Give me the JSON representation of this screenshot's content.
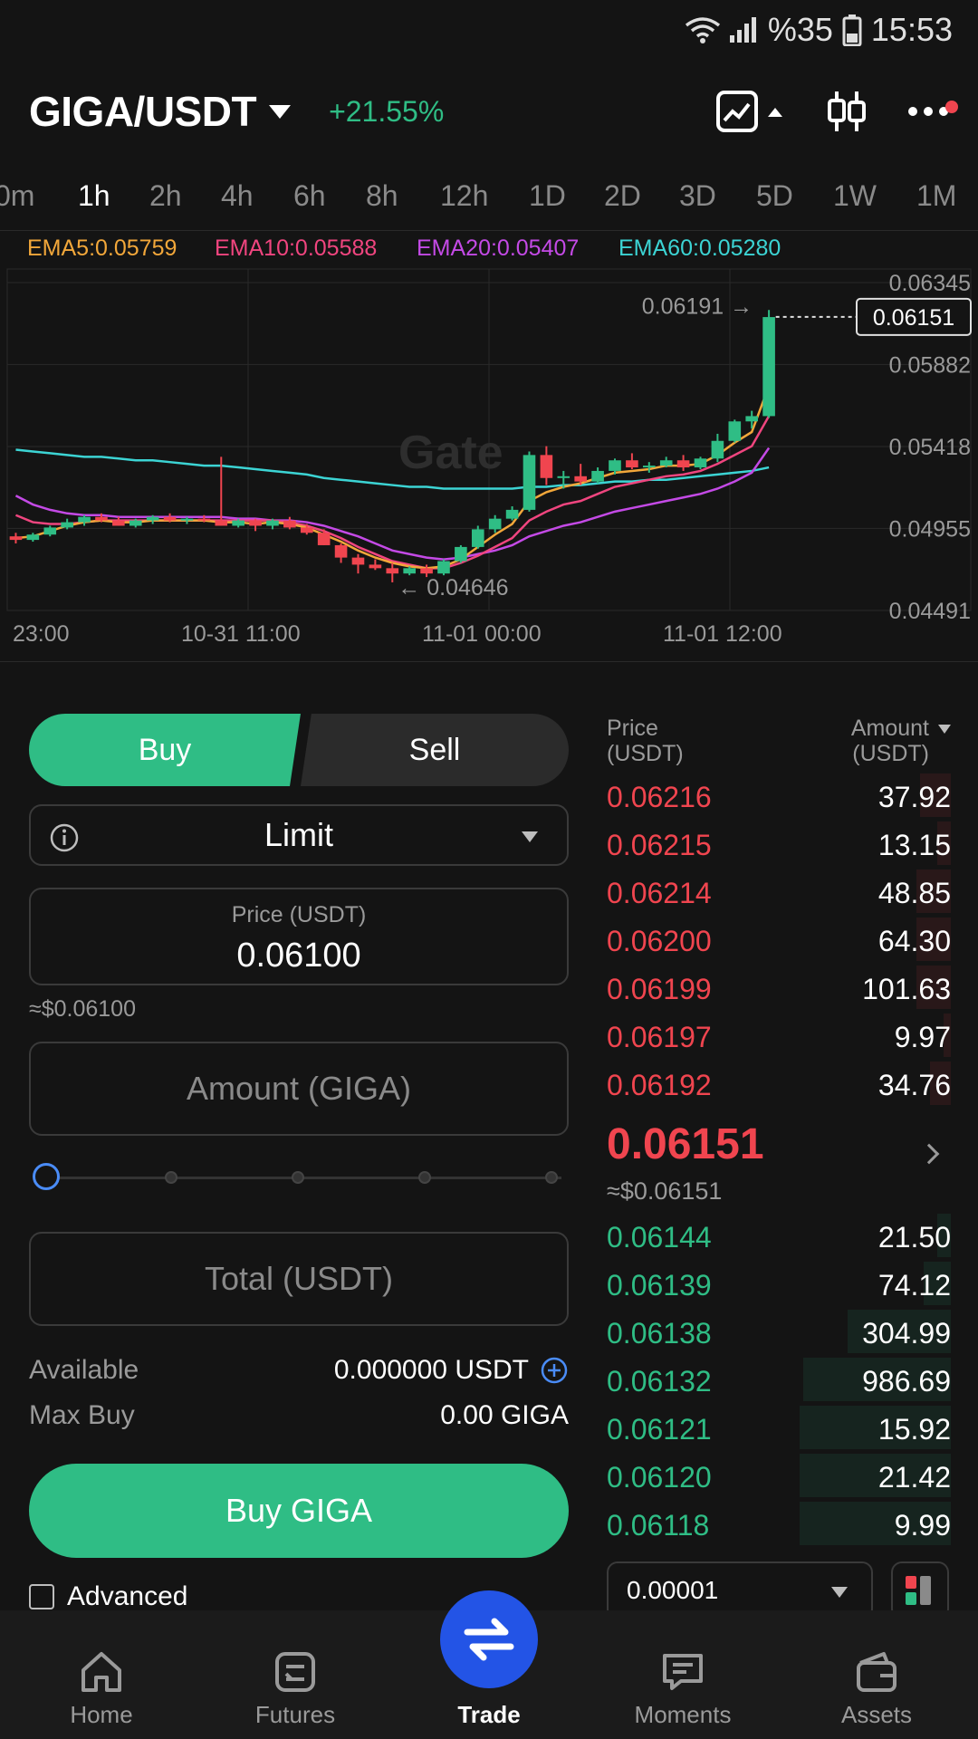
{
  "status_bar": {
    "battery": "%35",
    "time": "15:53"
  },
  "header": {
    "pair": "GIGA/USDT",
    "change": "+21.55%",
    "icons": [
      "chart-type-icon",
      "candlestick-icon",
      "more-icon"
    ]
  },
  "timeframes": [
    "0m",
    "1h",
    "2h",
    "4h",
    "6h",
    "8h",
    "12h",
    "1D",
    "2D",
    "3D",
    "5D",
    "1W",
    "1M"
  ],
  "active_timeframe": "1h",
  "ema": {
    "ema5": "EMA5:0.05759",
    "ema10": "EMA10:0.05588",
    "ema20": "EMA20:0.05407",
    "ema60": "EMA60:0.05280",
    "colors": {
      "ema5": "#f2a73a",
      "ema10": "#f0457f",
      "ema20": "#c44ae6",
      "ema60": "#3cd4d4"
    }
  },
  "chart_data": {
    "type": "candlestick",
    "y_ticks": [
      "0.06345",
      "0.05882",
      "0.05418",
      "0.04955",
      "0.04491"
    ],
    "ylim": [
      0.04491,
      0.06345
    ],
    "x_ticks": [
      "23:00",
      "10-31 11:00",
      "11-01 00:00",
      "11-01 12:00"
    ],
    "high_label": "0.06191",
    "low_label": "0.04646",
    "current_price_tag": "0.06151",
    "watermark": "Gate",
    "candles": [
      {
        "o": 0.0491,
        "h": 0.0493,
        "l": 0.0487,
        "c": 0.0489
      },
      {
        "o": 0.0489,
        "h": 0.0493,
        "l": 0.0488,
        "c": 0.0492
      },
      {
        "o": 0.0492,
        "h": 0.0497,
        "l": 0.0491,
        "c": 0.0496
      },
      {
        "o": 0.0496,
        "h": 0.0501,
        "l": 0.0495,
        "c": 0.0499
      },
      {
        "o": 0.0499,
        "h": 0.0503,
        "l": 0.0497,
        "c": 0.0502
      },
      {
        "o": 0.0502,
        "h": 0.0504,
        "l": 0.0499,
        "c": 0.05
      },
      {
        "o": 0.05,
        "h": 0.0502,
        "l": 0.0497,
        "c": 0.0497
      },
      {
        "o": 0.0497,
        "h": 0.0501,
        "l": 0.0496,
        "c": 0.05
      },
      {
        "o": 0.05,
        "h": 0.0503,
        "l": 0.0498,
        "c": 0.0502
      },
      {
        "o": 0.0502,
        "h": 0.0504,
        "l": 0.0499,
        "c": 0.05
      },
      {
        "o": 0.05,
        "h": 0.0502,
        "l": 0.0498,
        "c": 0.0501
      },
      {
        "o": 0.0501,
        "h": 0.0503,
        "l": 0.0499,
        "c": 0.05
      },
      {
        "o": 0.05,
        "h": 0.0536,
        "l": 0.0497,
        "c": 0.0497
      },
      {
        "o": 0.0497,
        "h": 0.0501,
        "l": 0.0496,
        "c": 0.05
      },
      {
        "o": 0.05,
        "h": 0.0501,
        "l": 0.0494,
        "c": 0.0497
      },
      {
        "o": 0.0497,
        "h": 0.0501,
        "l": 0.0495,
        "c": 0.05
      },
      {
        "o": 0.05,
        "h": 0.0502,
        "l": 0.0495,
        "c": 0.0496
      },
      {
        "o": 0.0496,
        "h": 0.0498,
        "l": 0.0492,
        "c": 0.0493
      },
      {
        "o": 0.0493,
        "h": 0.0495,
        "l": 0.0486,
        "c": 0.0486
      },
      {
        "o": 0.0486,
        "h": 0.0487,
        "l": 0.0476,
        "c": 0.0479
      },
      {
        "o": 0.0479,
        "h": 0.0481,
        "l": 0.047,
        "c": 0.0475
      },
      {
        "o": 0.0475,
        "h": 0.0478,
        "l": 0.0472,
        "c": 0.0473
      },
      {
        "o": 0.0473,
        "h": 0.0476,
        "l": 0.0465,
        "c": 0.047
      },
      {
        "o": 0.047,
        "h": 0.0474,
        "l": 0.0469,
        "c": 0.0473
      },
      {
        "o": 0.0473,
        "h": 0.0475,
        "l": 0.0468,
        "c": 0.047
      },
      {
        "o": 0.047,
        "h": 0.0478,
        "l": 0.0469,
        "c": 0.0477
      },
      {
        "o": 0.0477,
        "h": 0.0486,
        "l": 0.0476,
        "c": 0.0485
      },
      {
        "o": 0.0485,
        "h": 0.0497,
        "l": 0.0484,
        "c": 0.0495
      },
      {
        "o": 0.0495,
        "h": 0.0503,
        "l": 0.0493,
        "c": 0.0501
      },
      {
        "o": 0.0501,
        "h": 0.0508,
        "l": 0.05,
        "c": 0.0506
      },
      {
        "o": 0.0506,
        "h": 0.0539,
        "l": 0.0505,
        "c": 0.0537
      },
      {
        "o": 0.0537,
        "h": 0.0542,
        "l": 0.052,
        "c": 0.0524
      },
      {
        "o": 0.0524,
        "h": 0.0528,
        "l": 0.0518,
        "c": 0.0525
      },
      {
        "o": 0.0525,
        "h": 0.0532,
        "l": 0.052,
        "c": 0.0522
      },
      {
        "o": 0.0522,
        "h": 0.053,
        "l": 0.0521,
        "c": 0.0528
      },
      {
        "o": 0.0528,
        "h": 0.0535,
        "l": 0.0526,
        "c": 0.0534
      },
      {
        "o": 0.0534,
        "h": 0.0538,
        "l": 0.0529,
        "c": 0.053
      },
      {
        "o": 0.053,
        "h": 0.0533,
        "l": 0.0527,
        "c": 0.0531
      },
      {
        "o": 0.0531,
        "h": 0.0536,
        "l": 0.053,
        "c": 0.0534
      },
      {
        "o": 0.0534,
        "h": 0.0537,
        "l": 0.0528,
        "c": 0.053
      },
      {
        "o": 0.053,
        "h": 0.0536,
        "l": 0.0529,
        "c": 0.0535
      },
      {
        "o": 0.0535,
        "h": 0.0549,
        "l": 0.0533,
        "c": 0.0545
      },
      {
        "o": 0.0545,
        "h": 0.0557,
        "l": 0.0544,
        "c": 0.0556
      },
      {
        "o": 0.0556,
        "h": 0.0562,
        "l": 0.0552,
        "c": 0.0559
      },
      {
        "o": 0.0559,
        "h": 0.0619,
        "l": 0.0558,
        "c": 0.0615
      }
    ],
    "ema_lines": {
      "ema60": [
        0.054,
        0.0539,
        0.0538,
        0.0537,
        0.0536,
        0.0536,
        0.0535,
        0.0534,
        0.0534,
        0.0533,
        0.0532,
        0.0531,
        0.0531,
        0.053,
        0.0529,
        0.0528,
        0.0527,
        0.0526,
        0.0524,
        0.0523,
        0.0522,
        0.0521,
        0.052,
        0.0519,
        0.0519,
        0.0518,
        0.0518,
        0.0518,
        0.0518,
        0.0518,
        0.0519,
        0.0519,
        0.052,
        0.052,
        0.0521,
        0.0522,
        0.0522,
        0.0523,
        0.0523,
        0.0524,
        0.0525,
        0.0526,
        0.0527,
        0.0528,
        0.053
      ],
      "ema20": [
        0.0514,
        0.0509,
        0.0506,
        0.0504,
        0.0503,
        0.0503,
        0.0502,
        0.0502,
        0.0502,
        0.0502,
        0.0502,
        0.0502,
        0.0502,
        0.0501,
        0.0501,
        0.05,
        0.05,
        0.0499,
        0.0497,
        0.0494,
        0.0491,
        0.0487,
        0.0483,
        0.0481,
        0.0479,
        0.0478,
        0.0479,
        0.0481,
        0.0483,
        0.0486,
        0.0491,
        0.0494,
        0.0497,
        0.0499,
        0.0502,
        0.0505,
        0.0507,
        0.0509,
        0.0511,
        0.0513,
        0.0515,
        0.0518,
        0.0522,
        0.0527,
        0.0541
      ],
      "ema10": [
        0.0503,
        0.0499,
        0.0498,
        0.0498,
        0.0499,
        0.05,
        0.05,
        0.05,
        0.05,
        0.05,
        0.05,
        0.05,
        0.05,
        0.05,
        0.05,
        0.05,
        0.0499,
        0.0497,
        0.0494,
        0.049,
        0.0485,
        0.0481,
        0.0477,
        0.0475,
        0.0473,
        0.0473,
        0.0476,
        0.048,
        0.0485,
        0.049,
        0.05,
        0.0505,
        0.0509,
        0.0511,
        0.0515,
        0.0519,
        0.0521,
        0.0523,
        0.0525,
        0.0526,
        0.0528,
        0.0532,
        0.0537,
        0.0542,
        0.0559
      ],
      "ema5": [
        0.049,
        0.0491,
        0.0494,
        0.0497,
        0.0499,
        0.05,
        0.0499,
        0.0499,
        0.05,
        0.05,
        0.05,
        0.05,
        0.0499,
        0.0499,
        0.0498,
        0.0499,
        0.0498,
        0.0496,
        0.0492,
        0.0488,
        0.0483,
        0.0479,
        0.0476,
        0.0474,
        0.0473,
        0.0474,
        0.0478,
        0.0485,
        0.0492,
        0.0498,
        0.0511,
        0.0516,
        0.0519,
        0.0521,
        0.0524,
        0.0527,
        0.0528,
        0.0529,
        0.0531,
        0.0531,
        0.0532,
        0.0537,
        0.0544,
        0.055,
        0.0576
      ]
    }
  },
  "trade": {
    "buy_label": "Buy",
    "sell_label": "Sell",
    "order_type": "Limit",
    "price_label": "Price (USDT)",
    "price_value": "0.06100",
    "price_approx": "≈$0.06100",
    "amount_placeholder": "Amount (GIGA)",
    "total_placeholder": "Total (USDT)",
    "slider_percent": 0,
    "available_label": "Available",
    "available_value": "0.000000 USDT",
    "maxbuy_label": "Max Buy",
    "maxbuy_value": "0.00 GIGA",
    "submit_label": "Buy GIGA",
    "advanced_label": "Advanced"
  },
  "orderbook": {
    "price_header": "Price",
    "price_unit": "(USDT)",
    "amount_header": "Amount",
    "amount_unit": "(USDT)",
    "asks": [
      {
        "price": "0.06216",
        "amount": "37.92",
        "depth": 0.09
      },
      {
        "price": "0.06215",
        "amount": "13.15",
        "depth": 0.04
      },
      {
        "price": "0.06214",
        "amount": "48.85",
        "depth": 0.1
      },
      {
        "price": "0.06200",
        "amount": "64.30",
        "depth": 0.1
      },
      {
        "price": "0.06199",
        "amount": "101.63",
        "depth": 0.1
      },
      {
        "price": "0.06197",
        "amount": "9.97",
        "depth": 0.02
      },
      {
        "price": "0.06192",
        "amount": "34.76",
        "depth": 0.06
      }
    ],
    "last_price": "0.06151",
    "last_approx": "≈$0.06151",
    "bids": [
      {
        "price": "0.06144",
        "amount": "21.50",
        "depth": 0.04
      },
      {
        "price": "0.06139",
        "amount": "74.12",
        "depth": 0.08
      },
      {
        "price": "0.06138",
        "amount": "304.99",
        "depth": 0.3
      },
      {
        "price": "0.06132",
        "amount": "986.69",
        "depth": 0.43
      },
      {
        "price": "0.06121",
        "amount": "15.92",
        "depth": 0.44
      },
      {
        "price": "0.06120",
        "amount": "21.42",
        "depth": 0.44
      },
      {
        "price": "0.06118",
        "amount": "9.99",
        "depth": 0.44
      }
    ],
    "precision": "0.00001"
  },
  "bottom_nav": [
    {
      "label": "Home",
      "icon": "home-icon"
    },
    {
      "label": "Futures",
      "icon": "futures-icon"
    },
    {
      "label": "Trade",
      "icon": "trade-icon"
    },
    {
      "label": "Moments",
      "icon": "moments-icon"
    },
    {
      "label": "Assets",
      "icon": "wallet-icon"
    }
  ],
  "colors": {
    "up": "#2fbd85",
    "down": "#f0454f",
    "accent": "#2354e6",
    "bg": "#141414"
  }
}
